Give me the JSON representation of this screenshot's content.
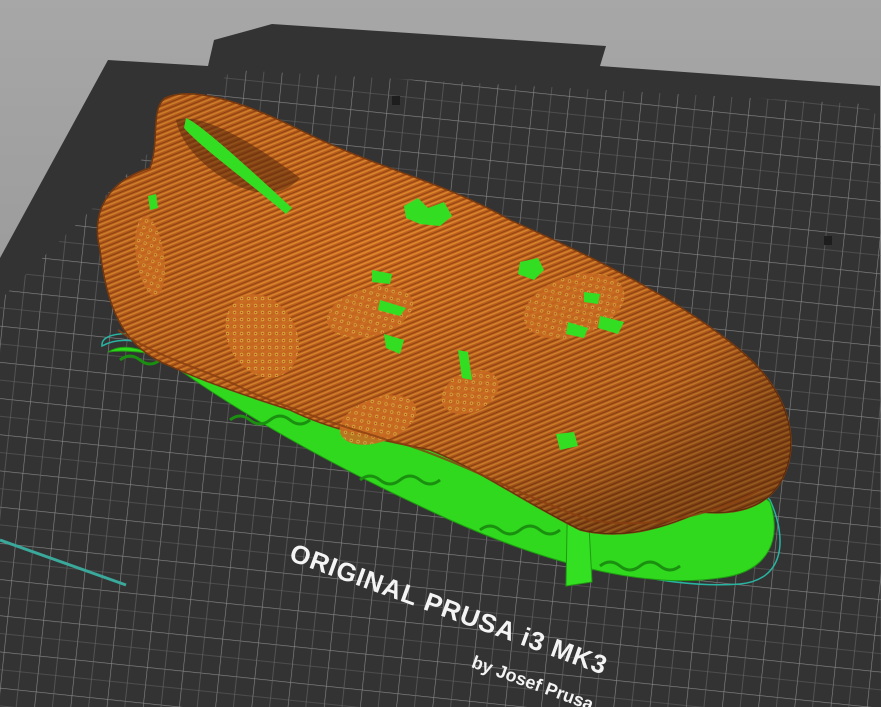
{
  "viewport": {
    "bed_brand_line": "ORIGINAL PRUSA i3 MK3",
    "bed_credit_line": "by Josef Prusa",
    "model_name": "shoe",
    "colors": {
      "background": "#9a9a9a",
      "bed_plate": "#3a3a3a",
      "bed_grid": "#8a8a8a",
      "extrusion_perimeter": "#c8641e",
      "extrusion_support": "#33dd22",
      "skirt_line": "#28b4a0"
    }
  }
}
